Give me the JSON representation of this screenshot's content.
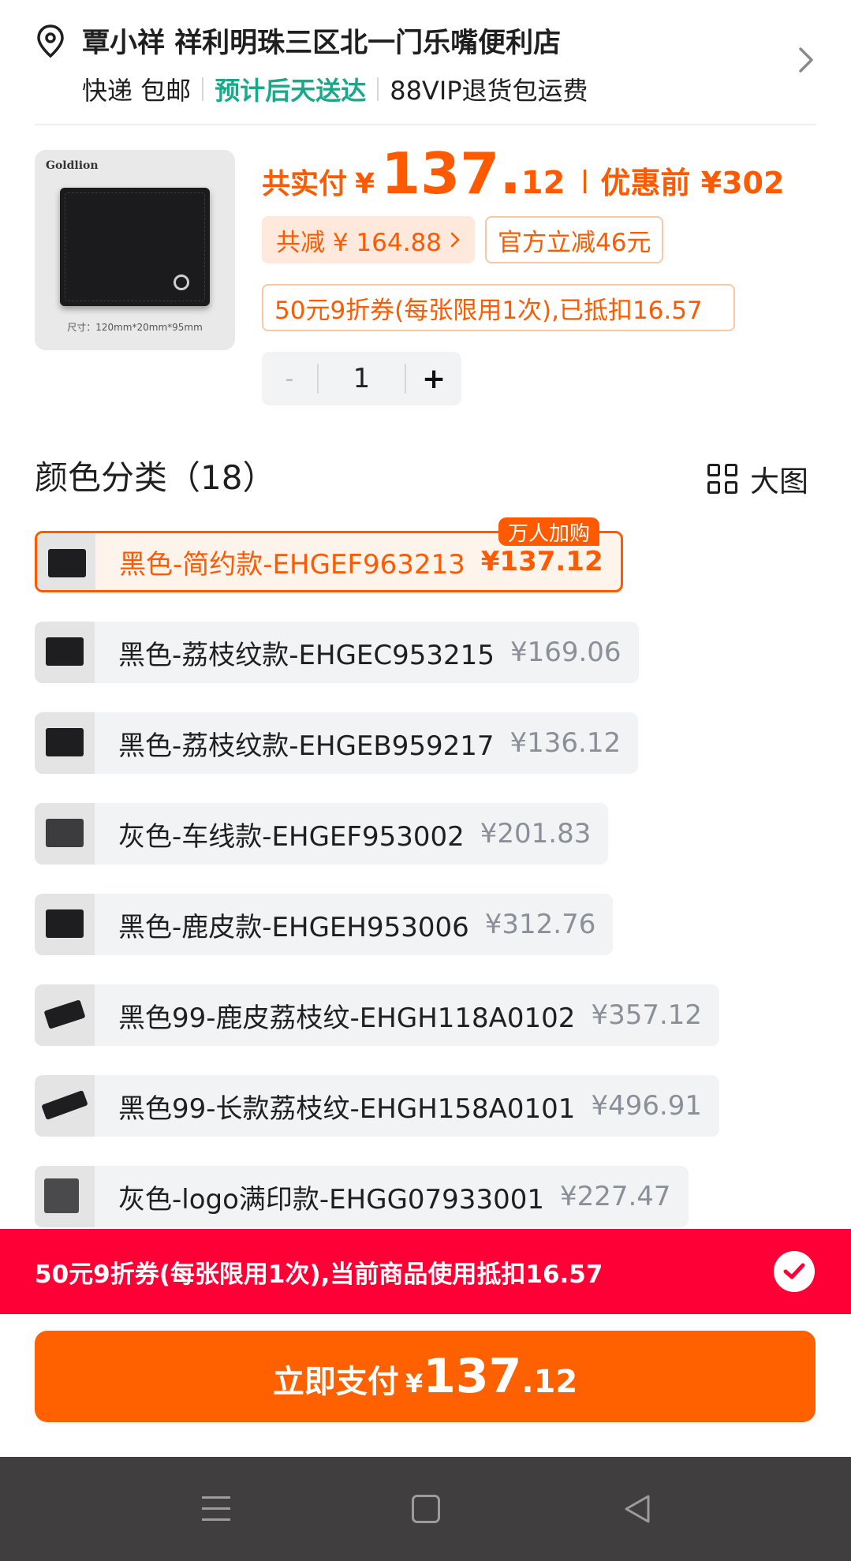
{
  "address": {
    "name": "覃小祥 祥利明珠三区北一门乐嘴便利店",
    "delivery": "快递 包邮",
    "eta": "预计后天送达",
    "service": "88VIP退货包运费"
  },
  "product": {
    "brand_mark": "Goldlion",
    "size_text": "尺寸：120mm*20mm*95mm",
    "pay_label": "共实付",
    "currency": "¥",
    "price_int": "137.",
    "price_dec": "12",
    "before_label": "优惠前 ¥302",
    "total_discount": "共减 ¥ 164.88",
    "official_off": "官方立减46元",
    "coupon_text": "50元9折券(每张限用1次),已抵扣16.57",
    "quantity": "1",
    "minus": "-",
    "plus": "+"
  },
  "colors": {
    "title": "颜色分类（18）",
    "big_view": "大图",
    "hot_badge": "万人加购",
    "options": [
      {
        "name": "黑色-简约款-EHGEF963213",
        "price": "¥137.12",
        "selected": true
      },
      {
        "name": "黑色-荔枝纹款-EHGEC953215",
        "price": "¥169.06"
      },
      {
        "name": "黑色-荔枝纹款-EHGEB959217",
        "price": "¥136.12"
      },
      {
        "name": "灰色-车线款-EHGEF953002",
        "price": "¥201.83"
      },
      {
        "name": "黑色-鹿皮款-EHGEH953006",
        "price": "¥312.76"
      },
      {
        "name": "黑色99-鹿皮荔枝纹-EHGH118A0102",
        "price": "¥357.12"
      },
      {
        "name": "黑色99-长款荔枝纹-EHGH158A0101",
        "price": "¥496.91"
      },
      {
        "name": "灰色-logo满印款-EHGG07933001",
        "price": "¥227.47"
      }
    ]
  },
  "coupon_bar": {
    "text": "50元9折券(每张限用1次),当前商品使用抵扣16.57",
    "checked": true
  },
  "pay_button": {
    "label": "立即支付",
    "currency": "¥",
    "price_int": "137",
    "price_dec": ".12"
  },
  "theme": {
    "accent": "#ff5a00",
    "green": "#17a98a",
    "coupon_red": "#ff0036",
    "pay_orange": "#ff6000"
  }
}
